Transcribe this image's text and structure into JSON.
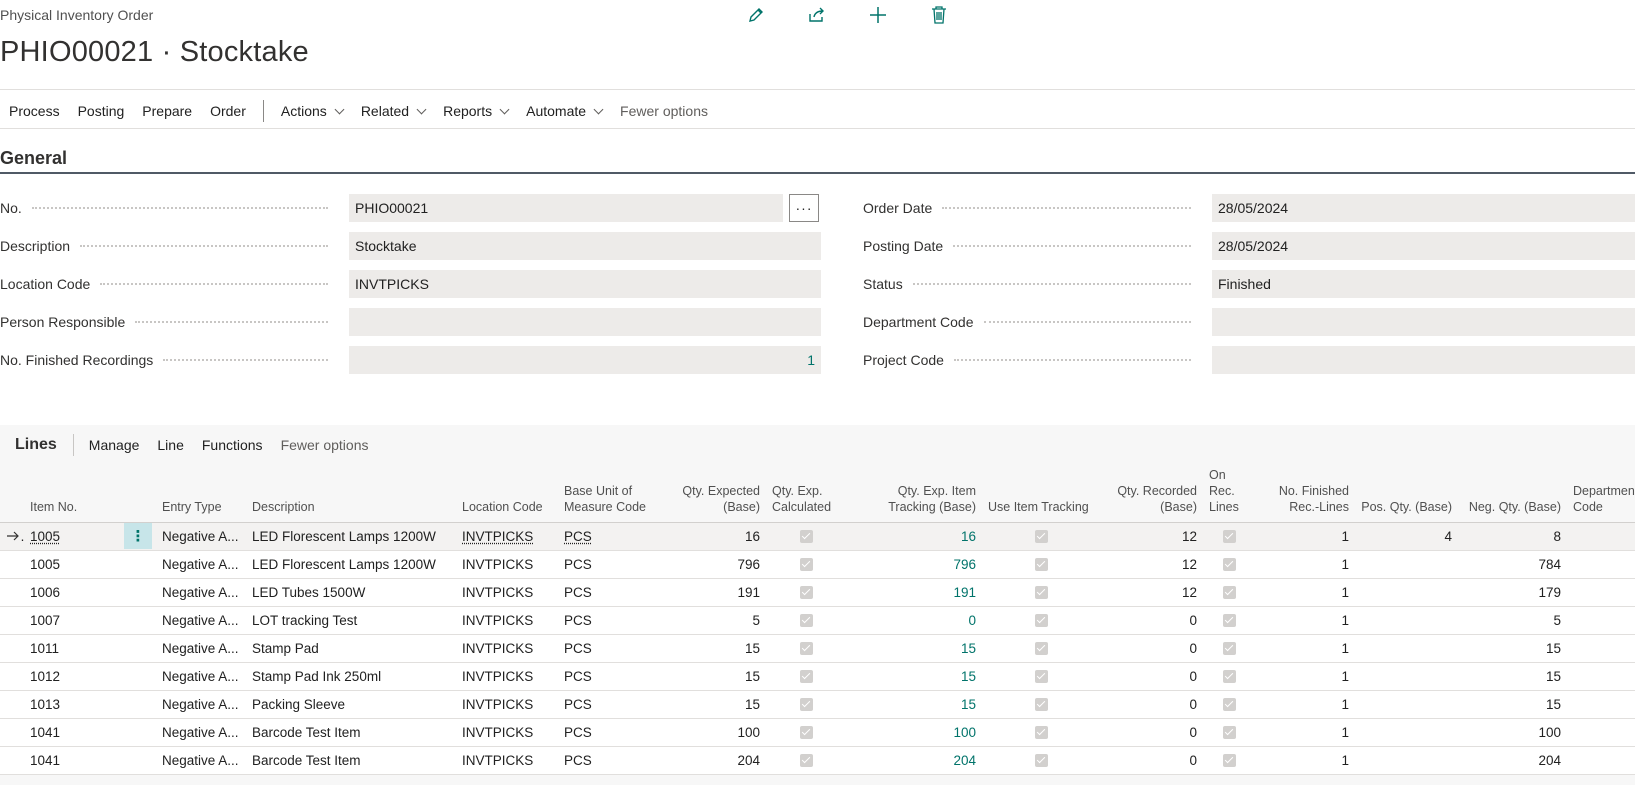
{
  "header": {
    "breadcrumb": "Physical Inventory Order",
    "title": "PHIO00021 · Stocktake"
  },
  "actionbar": {
    "items": [
      "Process",
      "Posting",
      "Prepare",
      "Order"
    ],
    "menus": [
      "Actions",
      "Related",
      "Reports",
      "Automate"
    ],
    "fewer": "Fewer options"
  },
  "general": {
    "title": "General",
    "left": [
      {
        "label": "No.",
        "value": "PHIO00021"
      },
      {
        "label": "Description",
        "value": "Stocktake"
      },
      {
        "label": "Location Code",
        "value": "INVTPICKS"
      },
      {
        "label": "Person Responsible",
        "value": ""
      },
      {
        "label": "No. Finished Recordings",
        "value": "1"
      }
    ],
    "right": [
      {
        "label": "Order Date",
        "value": "28/05/2024"
      },
      {
        "label": "Posting Date",
        "value": "28/05/2024"
      },
      {
        "label": "Status",
        "value": "Finished"
      },
      {
        "label": "Department Code",
        "value": ""
      },
      {
        "label": "Project Code",
        "value": ""
      }
    ],
    "lookup": "···"
  },
  "lines": {
    "title": "Lines",
    "actions": [
      "Manage",
      "Line",
      "Functions"
    ],
    "fewer": "Fewer options",
    "columns": {
      "item_no": "Item No.",
      "entry_type": "Entry Type",
      "description": "Description",
      "location": "Location Code",
      "uom": "Base Unit of Measure Code",
      "qty_expected": "Qty. Expected (Base)",
      "qty_exp_calc": "Qty. Exp. Calculated",
      "qty_exp_tracking": "Qty. Exp. Item Tracking (Base)",
      "use_tracking": "Use Item Tracking",
      "qty_recorded": "Qty. Recorded (Base)",
      "on_rec_lines": "On Rec. Lines",
      "no_finished": "No. Finished Rec.-Lines",
      "pos_qty": "Pos. Qty. (Base)",
      "neg_qty": "Neg. Qty. (Base)",
      "dept": "Department Code"
    },
    "rows": [
      {
        "item": "1005",
        "type": "Negative A...",
        "desc": "LED Florescent Lamps 1200W",
        "loc": "INVTPICKS",
        "uom": "PCS",
        "exp": "16",
        "track": "16",
        "rec": "12",
        "fin": "1",
        "pos": "4",
        "neg": "8"
      },
      {
        "item": "1005",
        "type": "Negative A...",
        "desc": "LED Florescent Lamps 1200W",
        "loc": "INVTPICKS",
        "uom": "PCS",
        "exp": "796",
        "track": "796",
        "rec": "12",
        "fin": "1",
        "pos": "",
        "neg": "784"
      },
      {
        "item": "1006",
        "type": "Negative A...",
        "desc": "LED Tubes 1500W",
        "loc": "INVTPICKS",
        "uom": "PCS",
        "exp": "191",
        "track": "191",
        "rec": "12",
        "fin": "1",
        "pos": "",
        "neg": "179"
      },
      {
        "item": "1007",
        "type": "Negative A...",
        "desc": "LOT tracking Test",
        "loc": "INVTPICKS",
        "uom": "PCS",
        "exp": "5",
        "track": "0",
        "rec": "0",
        "fin": "1",
        "pos": "",
        "neg": "5"
      },
      {
        "item": "1011",
        "type": "Negative A...",
        "desc": "Stamp Pad",
        "loc": "INVTPICKS",
        "uom": "PCS",
        "exp": "15",
        "track": "15",
        "rec": "0",
        "fin": "1",
        "pos": "",
        "neg": "15"
      },
      {
        "item": "1012",
        "type": "Negative A...",
        "desc": "Stamp Pad Ink 250ml",
        "loc": "INVTPICKS",
        "uom": "PCS",
        "exp": "15",
        "track": "15",
        "rec": "0",
        "fin": "1",
        "pos": "",
        "neg": "15"
      },
      {
        "item": "1013",
        "type": "Negative A...",
        "desc": "Packing Sleeve",
        "loc": "INVTPICKS",
        "uom": "PCS",
        "exp": "15",
        "track": "15",
        "rec": "0",
        "fin": "1",
        "pos": "",
        "neg": "15"
      },
      {
        "item": "1041",
        "type": "Negative A...",
        "desc": "Barcode Test Item",
        "loc": "INVTPICKS",
        "uom": "PCS",
        "exp": "100",
        "track": "100",
        "rec": "0",
        "fin": "1",
        "pos": "",
        "neg": "100"
      },
      {
        "item": "1041",
        "type": "Negative A...",
        "desc": "Barcode Test Item",
        "loc": "INVTPICKS",
        "uom": "PCS",
        "exp": "204",
        "track": "204",
        "rec": "0",
        "fin": "1",
        "pos": "",
        "neg": "204"
      }
    ]
  },
  "icons": [
    "edit-icon",
    "share-icon",
    "new-icon",
    "delete-icon"
  ],
  "colors": {
    "accent": "#00736a",
    "field_bg": "#edebe9"
  }
}
